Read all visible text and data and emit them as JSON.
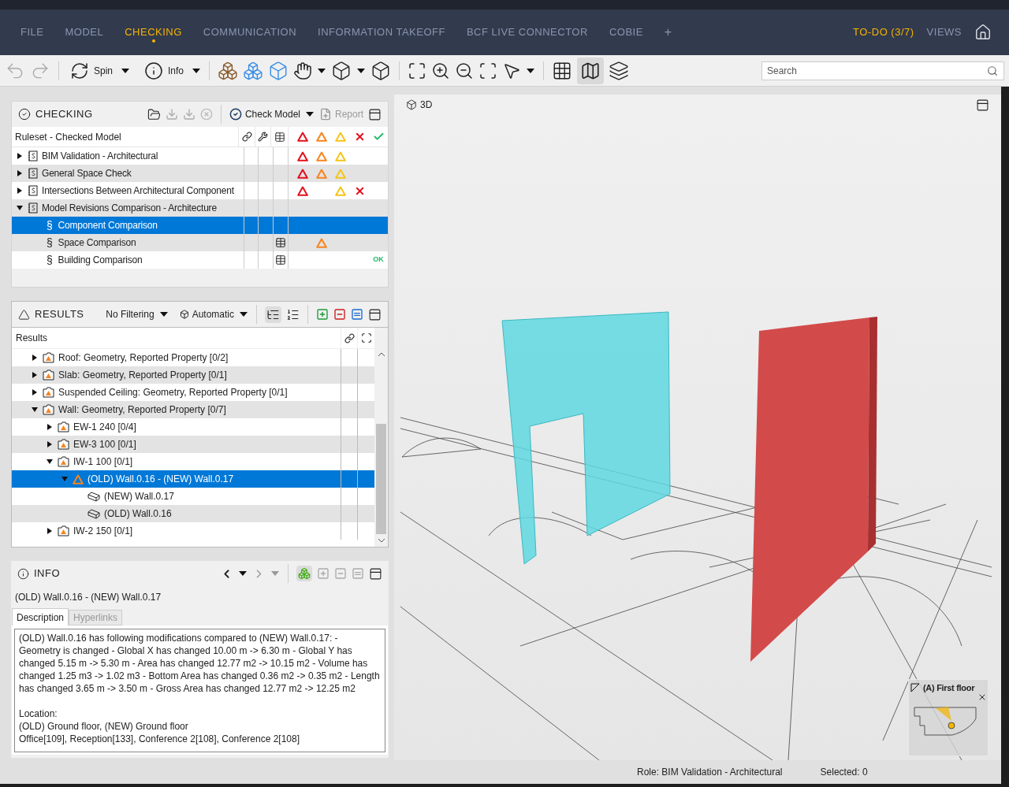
{
  "menu": {
    "items": [
      {
        "label": "FILE",
        "selected": false
      },
      {
        "label": "MODEL",
        "selected": false
      },
      {
        "label": "CHECKING",
        "selected": true
      },
      {
        "label": "COMMUNICATION",
        "selected": false
      },
      {
        "label": "INFORMATION TAKEOFF",
        "selected": false
      },
      {
        "label": "BCF LIVE CONNECTOR",
        "selected": false
      },
      {
        "label": "COBIE",
        "selected": false
      }
    ],
    "add": "+",
    "todo": "TO-DO (3/7)",
    "views": "VIEWS"
  },
  "toolbar": {
    "spin": "Spin",
    "info": "Info",
    "map_active": true,
    "search": {
      "placeholder": "Search"
    }
  },
  "checking": {
    "title": "CHECKING",
    "symbol": "§",
    "check_model": "Check Model",
    "report": {
      "label": "Report",
      "disabled": true
    },
    "column": "Ruleset - Checked Model",
    "rows": [
      {
        "label": "BIM Validation - Architectural",
        "kind": "ruleset",
        "expanded": false,
        "selected": false,
        "table": false,
        "critical": true,
        "major": true,
        "minor": true,
        "rejected": false
      },
      {
        "label": "General Space Check",
        "kind": "ruleset",
        "expanded": false,
        "selected": false,
        "table": false,
        "critical": true,
        "major": true,
        "minor": true,
        "rejected": false
      },
      {
        "label": "Intersections Between Architectural Component",
        "kind": "ruleset",
        "expanded": false,
        "selected": false,
        "table": false,
        "critical": true,
        "major": false,
        "minor": true,
        "rejected": true
      },
      {
        "label": "Model Revisions Comparison - Architecture",
        "kind": "ruleset",
        "expanded": true,
        "selected": false,
        "table": false,
        "critical": false,
        "major": false,
        "minor": false,
        "rejected": false,
        "children": [
          {
            "label": "Component Comparison",
            "kind": "rule",
            "selected": true,
            "table": false,
            "critical": false,
            "major": false,
            "minor": false,
            "rejected": false
          },
          {
            "label": "Space Comparison",
            "kind": "rule",
            "selected": false,
            "table": true,
            "critical": false,
            "major": true,
            "minor": false,
            "rejected": false
          },
          {
            "label": "Building Comparison",
            "kind": "rule",
            "selected": false,
            "table": true,
            "critical": false,
            "major": false,
            "minor": false,
            "rejected": false,
            "status": "OK"
          }
        ]
      }
    ]
  },
  "results": {
    "title": "RESULTS",
    "filter": "No Filtering",
    "mode": "Automatic",
    "column": "Results",
    "rows": [
      {
        "label": "Roof: Geometry, Reported Property [0/2]",
        "kind": "group",
        "expanded": false,
        "selected": false
      },
      {
        "label": "Slab: Geometry, Reported Property [0/1]",
        "kind": "group",
        "expanded": false,
        "selected": false
      },
      {
        "label": "Suspended Ceiling: Geometry, Reported Property [0/1]",
        "kind": "group",
        "expanded": false,
        "selected": false
      },
      {
        "label": "Wall: Geometry, Reported Property [0/7]",
        "kind": "group",
        "expanded": true,
        "selected": false,
        "children": [
          {
            "label": "EW-1 240 [0/4]",
            "kind": "group",
            "expanded": false,
            "selected": false
          },
          {
            "label": "EW-3 100 [0/1]",
            "kind": "group",
            "expanded": false,
            "selected": false
          },
          {
            "label": "IW-1 100 [0/1]",
            "kind": "group",
            "expanded": true,
            "selected": false,
            "children": [
              {
                "label": "(OLD) Wall.0.16 - (NEW) Wall.0.17",
                "kind": "issue",
                "expanded": true,
                "selected": true,
                "children": [
                  {
                    "label": "(NEW) Wall.0.17",
                    "kind": "component",
                    "selected": false
                  },
                  {
                    "label": "(OLD) Wall.0.16",
                    "kind": "component",
                    "selected": false
                  }
                ]
              }
            ]
          },
          {
            "label": "IW-2 150 [0/1]",
            "kind": "group",
            "expanded": false,
            "selected": false
          }
        ]
      }
    ]
  },
  "info": {
    "title": "INFO",
    "heading": "(OLD) Wall.0.16 - (NEW) Wall.0.17",
    "tabs": [
      {
        "label": "Description",
        "selected": true
      },
      {
        "label": "Hyperlinks",
        "selected": false
      }
    ],
    "description": "(OLD) Wall.0.16 has following modifications compared to (NEW) Wall.0.17: - Geometry is changed - Global X has changed 10.00 m -> 6.30 m - Global Y has changed 5.15 m -> 5.30 m - Area has changed 12.77 m2 -> 10.15 m2 - Volume has changed 1.25 m3 -> 1.02 m3 - Bottom Area has changed 0.36 m2 -> 0.35 m2 - Length has changed 3.65 m -> 3.50 m - Gross Area has changed 12.77 m2 -> 12.25 m2",
    "location": [
      "Location:",
      "(OLD) Ground floor, (NEW) Ground floor",
      "Office[109], Reception[133], Conference 2[108], Conference 2[108]"
    ]
  },
  "viewport": {
    "title": "3D",
    "minimap": "(A) First floor"
  },
  "status_bar": {
    "role": "Role: BIM Validation - Architectural",
    "selected": "Selected: 0"
  }
}
